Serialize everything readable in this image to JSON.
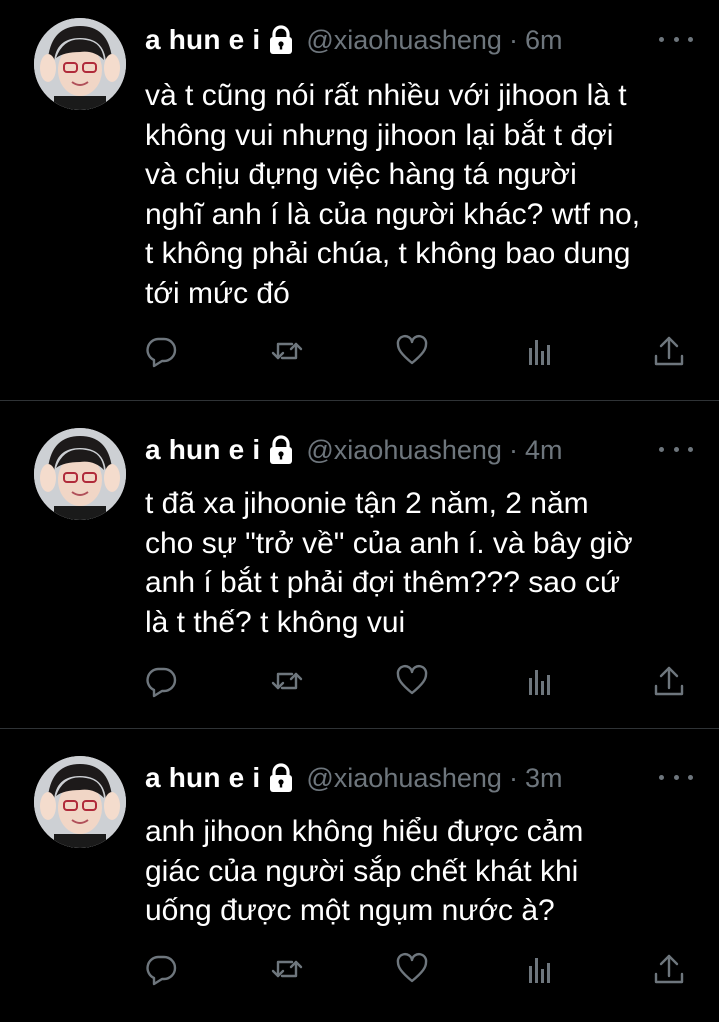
{
  "tweets": [
    {
      "display_name": "a hun e i",
      "handle": "@xiaohuasheng",
      "separator": "·",
      "time": "6m",
      "text": "và t cũng nói rất nhiều với jihoon là t\nkhông vui nhưng jihoon lại bắt t đợi\nvà chịu đựng việc hàng tá người\nnghĩ anh í là của người khác? wtf no,\nt không phải chúa, t không bao dung\ntới mức đó"
    },
    {
      "display_name": "a hun e i",
      "handle": "@xiaohuasheng",
      "separator": "·",
      "time": "4m",
      "text": "t đã xa jihoonie tận 2 năm, 2 năm\ncho sự \"trở về\" của anh í. và bây giờ\nanh í bắt t phải đợi thêm??? sao cứ\nlà t thế? t không vui"
    },
    {
      "display_name": "a hun e i",
      "handle": "@xiaohuasheng",
      "separator": "·",
      "time": "3m",
      "text": "anh jihoon không hiểu được cảm\ngiác của người sắp chết khát khi\nuống được một ngụm nước à?"
    }
  ],
  "icons": {
    "lock": "lock-icon",
    "more": "more-icon",
    "reply": "reply-icon",
    "retweet": "retweet-icon",
    "like": "heart-icon",
    "analytics": "analytics-icon",
    "share": "share-icon"
  },
  "colors": {
    "background": "#000000",
    "text": "#ffffff",
    "secondary": "#6e767d",
    "divider": "#2f3336"
  }
}
